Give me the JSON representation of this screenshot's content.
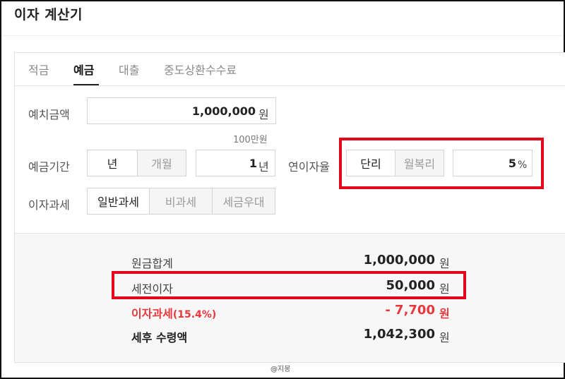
{
  "app": {
    "title": "이자 계산기"
  },
  "tabs": [
    {
      "label": "적금",
      "active": false
    },
    {
      "label": "예금",
      "active": true
    },
    {
      "label": "대출",
      "active": false
    },
    {
      "label": "중도상환수수료",
      "active": false
    }
  ],
  "deposit_amount": {
    "label": "예치금액",
    "value": "1,000,000",
    "unit": "원",
    "hint": "100만원"
  },
  "period": {
    "label": "예금기간",
    "options": [
      {
        "label": "년",
        "selected": true
      },
      {
        "label": "개월",
        "selected": false
      }
    ],
    "value": "1",
    "unit": "년"
  },
  "rate": {
    "label": "연이자율",
    "options": [
      {
        "label": "단리",
        "selected": true
      },
      {
        "label": "월복리",
        "selected": false
      }
    ],
    "value": "5",
    "unit": "%"
  },
  "taxation": {
    "label": "이자과세",
    "options": [
      {
        "label": "일반과세",
        "selected": true
      },
      {
        "label": "비과세",
        "selected": false
      },
      {
        "label": "세금우대",
        "selected": false
      }
    ]
  },
  "results": {
    "principal": {
      "label": "원금합계",
      "value": "1,000,000",
      "unit": "원"
    },
    "pretax_interest": {
      "label": "세전이자",
      "value": "50,000",
      "unit": "원"
    },
    "interest_tax": {
      "label": "이자과세",
      "rate": "(15.4%)",
      "value": "- 7,700",
      "unit": "원"
    },
    "net_amount": {
      "label": "세후 수령액",
      "value": "1,042,300",
      "unit": "원"
    }
  },
  "watermark": "@지몽",
  "colors": {
    "highlight": "#e2071b",
    "tax_red": "#e8383d"
  }
}
